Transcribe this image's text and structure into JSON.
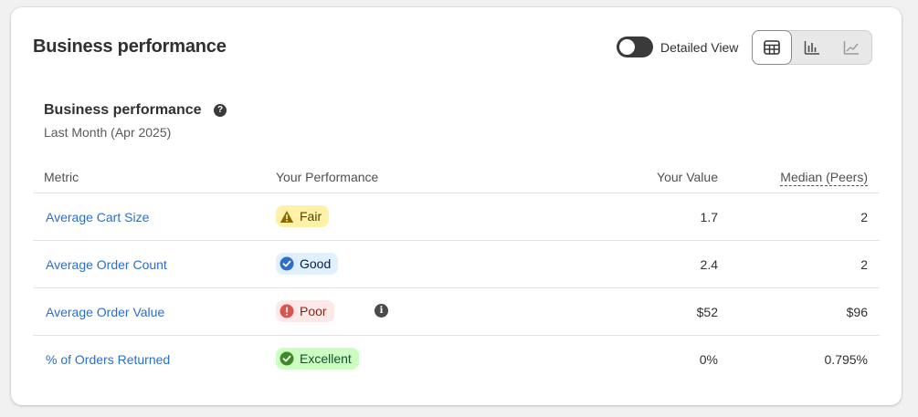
{
  "header": {
    "title": "Business performance",
    "toggle_label": "Detailed View",
    "view_modes": [
      "table-view-icon",
      "bar-chart-icon",
      "line-chart-icon"
    ]
  },
  "section": {
    "title": "Business performance",
    "help": "?",
    "period": "Last Month (Apr 2025)"
  },
  "table": {
    "columns": {
      "metric": "Metric",
      "performance": "Your Performance",
      "your_value": "Your Value",
      "median": "Median (Peers)"
    },
    "rows": [
      {
        "metric": "Average Cart Size",
        "rating": "Fair",
        "your_value": "1.7",
        "median": "2"
      },
      {
        "metric": "Average Order Count",
        "rating": "Good",
        "your_value": "2.4",
        "median": "2"
      },
      {
        "metric": "Average Order Value",
        "rating": "Poor",
        "info": "i",
        "your_value": "$52",
        "median": "$96"
      },
      {
        "metric": "% of Orders Returned",
        "rating": "Excellent",
        "your_value": "0%",
        "median": "0.795%"
      }
    ]
  },
  "colors": {
    "link": "#2c6ecb",
    "fair_bg": "#fff1a8",
    "good_bg": "#e0f0ff",
    "poor_bg": "#fee9e8",
    "excellent_bg": "#cdfec1"
  }
}
